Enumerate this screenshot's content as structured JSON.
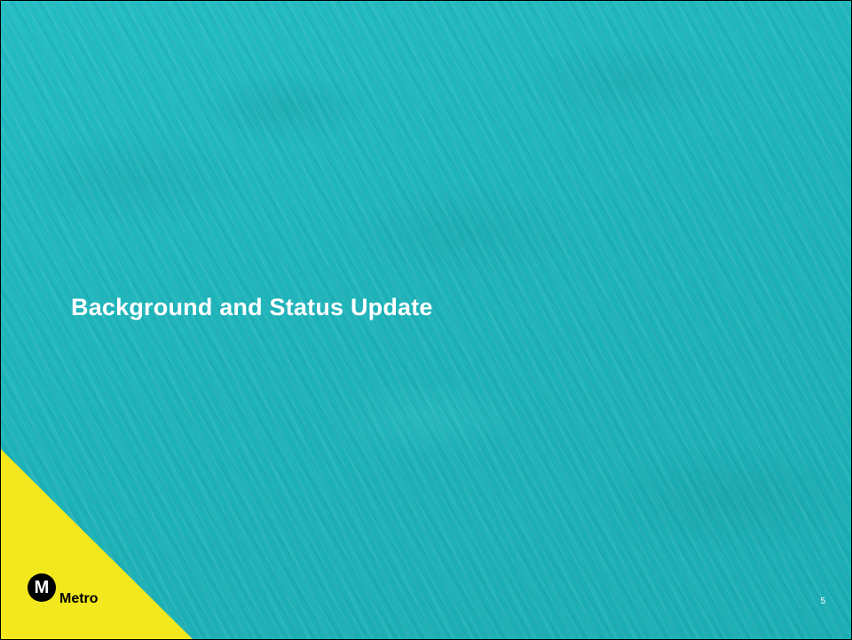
{
  "slide": {
    "title": "Background and Status Update",
    "page_number": "5",
    "logo": {
      "mark_letter": "M",
      "wordmark": "Metro"
    }
  },
  "colors": {
    "background": "#1fb5bb",
    "accent_yellow": "#f3e81d",
    "title_text": "#ffffff",
    "logo": "#000000"
  }
}
